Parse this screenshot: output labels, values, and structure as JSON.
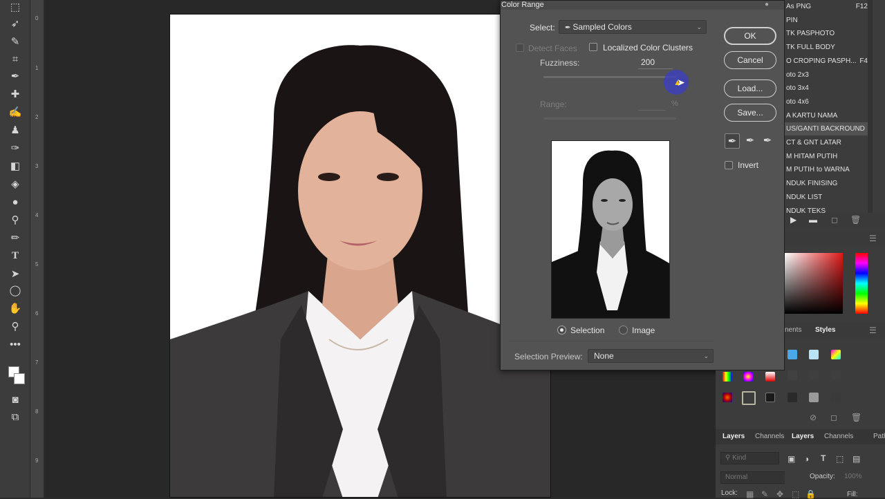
{
  "dialog": {
    "title": "Color Range",
    "select_label": "Select:",
    "select_value": "Sampled Colors",
    "detect_faces": "Detect Faces",
    "localized_clusters": "Localized Color Clusters",
    "fuzziness_label": "Fuzziness:",
    "fuzziness_value": "200",
    "fuzziness_fraction": 1.0,
    "range_label": "Range:",
    "range_unit": "%",
    "radio_selection": "Selection",
    "radio_image": "Image",
    "preview_label": "Selection Preview:",
    "preview_value": "None",
    "buttons": {
      "ok": "OK",
      "cancel": "Cancel",
      "load": "Load...",
      "save": "Save..."
    },
    "invert": "Invert"
  },
  "ruler_numbers": [
    "0",
    "1",
    "2",
    "3",
    "4",
    "5",
    "6",
    "7",
    "8",
    "9"
  ],
  "actions": [
    {
      "label": "As  PNG",
      "key": "F12"
    },
    {
      "label": "PIN",
      "key": ""
    },
    {
      "label": "TK PASPHOTO",
      "key": ""
    },
    {
      "label": "TK FULL BODY",
      "key": ""
    },
    {
      "label": "O CROPING PASPH...",
      "key": "F4"
    },
    {
      "label": "oto 2x3",
      "key": ""
    },
    {
      "label": "oto 3x4",
      "key": ""
    },
    {
      "label": "oto 4x6",
      "key": ""
    },
    {
      "label": "A KARTU NAMA",
      "key": ""
    },
    {
      "label": "US/GANTI BACKROUND",
      "key": ""
    },
    {
      "label": "CT & GNT LATAR",
      "key": ""
    },
    {
      "label": "M HITAM PUTIH",
      "key": ""
    },
    {
      "label": "M PUTIH  to WARNA",
      "key": ""
    },
    {
      "label": "NDUK FINISING",
      "key": ""
    },
    {
      "label": "NDUK LIST",
      "key": ""
    },
    {
      "label": "NDUK TEKS",
      "key": ""
    }
  ],
  "panels": {
    "styles_tabs": [
      "nents",
      "Styles"
    ],
    "layers_tabs": [
      "Layers",
      "Channels",
      "Paths"
    ],
    "kind_placeholder": "Kind",
    "blend_mode": "Normal",
    "opacity_label": "Opacity:",
    "opacity_value": "100%",
    "lock_label": "Lock:",
    "fill_label": "Fill:"
  }
}
